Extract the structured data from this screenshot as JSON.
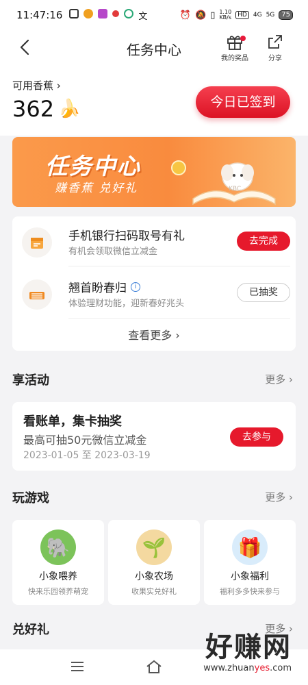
{
  "status_bar": {
    "time": "11:47:16",
    "speed_value": "1.10",
    "speed_unit": "KB/s",
    "signal_hd": "HD",
    "network_4g": "4G",
    "network_5g": "5G",
    "battery": "75"
  },
  "header": {
    "title": "任务中心",
    "prizes_label": "我的奖品",
    "share_label": "分享"
  },
  "balance": {
    "label": "可用香蕉",
    "value": "362"
  },
  "signin_button": "今日已签到",
  "banner": {
    "title": "任务中心",
    "subtitle": "赚香蕉 兑好礼",
    "mascot_text": "KBC"
  },
  "tasks": [
    {
      "name": "手机银行扫码取号有礼",
      "desc": "有机会领取微信立减金",
      "button": "去完成"
    },
    {
      "name": "翘首盼春归",
      "desc": "体验理财功能，迎新春好兆头",
      "button": "已抽奖"
    }
  ],
  "tasks_more": "查看更多",
  "activities": {
    "title": "享活动",
    "more": "更多",
    "item": {
      "title": "看账单，集卡抽奖",
      "desc": "最高可抽50元微信立减金",
      "date": "2023-01-05 至 2023-03-19",
      "button": "去参与"
    }
  },
  "games": {
    "title": "玩游戏",
    "more": "更多",
    "items": [
      {
        "name": "小象喂养",
        "desc": "快来乐园领养萌宠"
      },
      {
        "name": "小象农场",
        "desc": "收果实兑好礼"
      },
      {
        "name": "小象福利",
        "desc": "福利多多快来参与"
      }
    ]
  },
  "redeem": {
    "title": "兑好礼",
    "more": "更多"
  },
  "watermark": {
    "text": "好赚网",
    "url_pre": "www.zhuan",
    "url_hl": "yes",
    "url_post": ".com"
  },
  "colors": {
    "accent": "#e6192c",
    "banner": "#f98b3e"
  }
}
